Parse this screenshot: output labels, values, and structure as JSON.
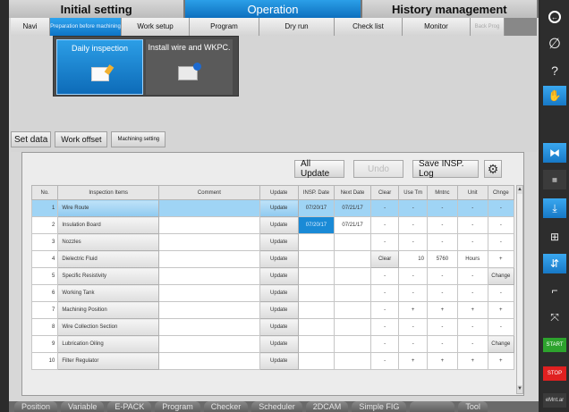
{
  "top_tabs": [
    "Initial setting",
    "Operation",
    "History management"
  ],
  "sub_tabs": [
    "Navi",
    "Preparation before machining",
    "Work setup",
    "Program",
    "Dry run",
    "Check list",
    "Monitor",
    "Back Prog"
  ],
  "modes": {
    "active": "Daily inspection",
    "other": "Install wire and WKPC."
  },
  "set_data": [
    "Set data",
    "Work offset",
    "Machining setting"
  ],
  "actions": {
    "all_update": "All Update",
    "undo": "Undo",
    "save": "Save INSP. Log",
    "settings_icon": "gear-icon"
  },
  "columns": [
    "No.",
    "Inspection Items",
    "Comment",
    "Update",
    "INSP. Date",
    "Next Date",
    "Clear",
    "Use Tm",
    "Mntnc",
    "Unit",
    "Chnge"
  ],
  "rows": [
    {
      "no": "1",
      "item": "Wire Route",
      "update": "Update",
      "insp": "07/20/17",
      "next": "07/21/17",
      "clear": "-",
      "use": "-",
      "mnt": "-",
      "unit": "-",
      "chg": "-"
    },
    {
      "no": "2",
      "item": "Insulation Board",
      "update": "Update",
      "insp": "07/20/17",
      "next": "07/21/17",
      "clear": "-",
      "use": "-",
      "mnt": "-",
      "unit": "-",
      "chg": "-"
    },
    {
      "no": "3",
      "item": "Nozzles",
      "update": "Update",
      "insp": "",
      "next": "",
      "clear": "-",
      "use": "-",
      "mnt": "-",
      "unit": "-",
      "chg": "-"
    },
    {
      "no": "4",
      "item": "Dielectric Fluid",
      "update": "Update",
      "insp": "",
      "next": "",
      "clear": "Clear",
      "use": "10",
      "mnt": "5760",
      "unit": "Hours",
      "chg": "+"
    },
    {
      "no": "5",
      "item": "Specific Resistivity",
      "update": "Update",
      "insp": "",
      "next": "",
      "clear": "-",
      "use": "-",
      "mnt": "-",
      "unit": "-",
      "chg": "Change"
    },
    {
      "no": "6",
      "item": "Working Tank",
      "update": "Update",
      "insp": "",
      "next": "",
      "clear": "-",
      "use": "-",
      "mnt": "-",
      "unit": "-",
      "chg": "-"
    },
    {
      "no": "7",
      "item": "Machining Position",
      "update": "Update",
      "insp": "",
      "next": "",
      "clear": "-",
      "use": "+",
      "mnt": "+",
      "unit": "+",
      "chg": "+"
    },
    {
      "no": "8",
      "item": "Wire Collection Section",
      "update": "Update",
      "insp": "",
      "next": "",
      "clear": "-",
      "use": "-",
      "mnt": "-",
      "unit": "-",
      "chg": "-"
    },
    {
      "no": "9",
      "item": "Lubrication Oiling",
      "update": "Update",
      "insp": "",
      "next": "",
      "clear": "-",
      "use": "-",
      "mnt": "-",
      "unit": "-",
      "chg": "Change"
    },
    {
      "no": "10",
      "item": "Filter Regulator",
      "update": "Update",
      "insp": "",
      "next": "",
      "clear": "-",
      "use": "+",
      "mnt": "+",
      "unit": "+",
      "chg": "+"
    }
  ],
  "bottom_tabs": [
    "Position",
    "Variable",
    "E-PACK",
    "Program",
    "Checker",
    "Scheduler",
    "2DCAM",
    "Simple FIG",
    "",
    "Tool"
  ],
  "right_bar": {
    "start": "START",
    "stop": "STOP",
    "extra": "eMnt.ar"
  }
}
